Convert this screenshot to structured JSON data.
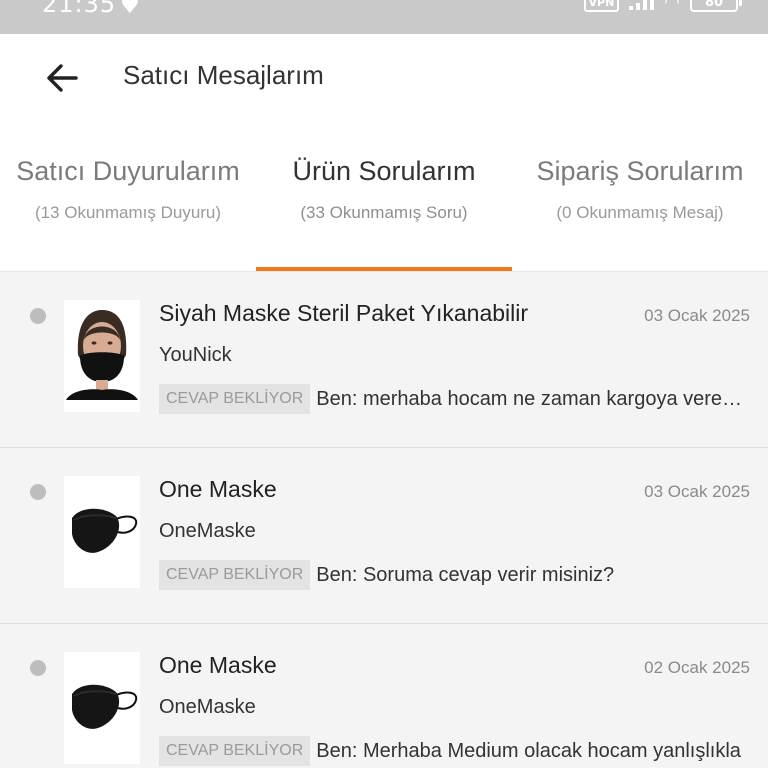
{
  "status_bar": {
    "time": "21:35",
    "vpn": "VPN",
    "battery": "80",
    "icons": [
      "heart-shield-icon",
      "signal-icon",
      "wifi-icon",
      "battery-icon"
    ]
  },
  "header": {
    "title": "Satıcı Mesajlarım",
    "back_icon": "arrow-left-icon"
  },
  "tabs": [
    {
      "label": "Satıcı Duyurularım",
      "sub": "(13 Okunmamış Duyuru)",
      "active": false
    },
    {
      "label": "Ürün Sorularım",
      "sub": "(33 Okunmamış Soru)",
      "active": true
    },
    {
      "label": "Sipariş Sorularım",
      "sub": "(0 Okunmamış Mesaj)",
      "active": false
    }
  ],
  "messages": [
    {
      "title": "Siyah Maske Steril Paket Yıkanabilir",
      "date": "03 Ocak 2025",
      "seller": "YouNick",
      "badge": "CEVAP BEKLİYOR",
      "text": "Ben: merhaba hocam ne zaman kargoya verecekseniz",
      "thumb": "woman-wearing-mask"
    },
    {
      "title": "One Maske",
      "date": "03 Ocak 2025",
      "seller": "OneMaske",
      "badge": "CEVAP BEKLİYOR",
      "text": "Ben: Soruma cevap verir misiniz?",
      "thumb": "black-mask"
    },
    {
      "title": "One Maske",
      "date": "02 Ocak 2025",
      "seller": "OneMaske",
      "badge": "CEVAP BEKLİYOR",
      "text": "Ben: Merhaba Medium olacak hocam yanlışlıkla",
      "thumb": "black-mask"
    }
  ],
  "colors": {
    "accent": "#f27a1a",
    "unread_dot": "#bdbdbd",
    "status_bar": "#c9c9c9"
  }
}
